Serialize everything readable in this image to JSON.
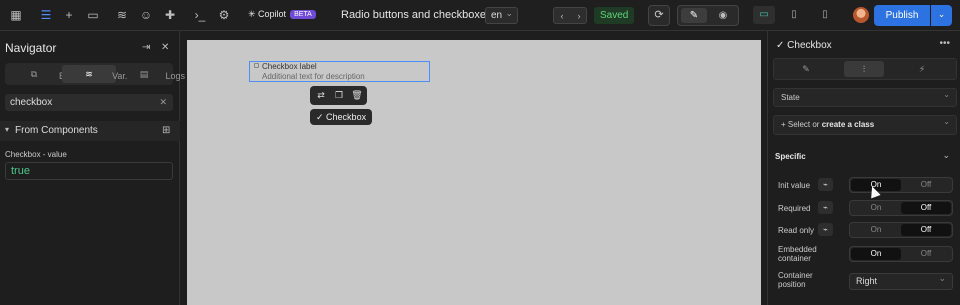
{
  "topbar": {
    "icons": [
      "grid-icon",
      "navigator-icon",
      "add-icon",
      "pages-icon",
      "cms-icon",
      "users-icon",
      "components-icon",
      "terminal-icon",
      "settings-icon"
    ],
    "copilot_label": "Copilot",
    "copilot_badge": "BETA",
    "page_title": "Radio buttons and checkboxes",
    "language": "en",
    "back": "‹",
    "forward": "›",
    "saved": "Saved",
    "publish": "Publish"
  },
  "navigator": {
    "title": "Navigator",
    "tabs": [
      {
        "label": "El."
      },
      {
        "label": "Var."
      },
      {
        "label": "Logs"
      }
    ],
    "search_value": "checkbox",
    "section_title": "From Components",
    "var_label": "Checkbox - value",
    "var_value": "true"
  },
  "canvas": {
    "checkbox_label": "Checkbox label",
    "checkbox_description": "Additional text for description",
    "selection_tag": "Checkbox"
  },
  "inspector": {
    "title": "Checkbox",
    "state_label": "State",
    "class_label_a": "+ Select or ",
    "class_label_b": "create a class",
    "specific_title": "Specific",
    "rows": [
      {
        "label": "Init value",
        "on": "On",
        "off": "Off",
        "selected": "on"
      },
      {
        "label": "Required",
        "on": "On",
        "off": "Off",
        "selected": "off"
      },
      {
        "label": "Read only",
        "on": "On",
        "off": "Off",
        "selected": "off"
      },
      {
        "label": "Embedded container",
        "on": "On",
        "off": "Off",
        "selected": "on"
      }
    ],
    "container_position_label": "Container position",
    "container_position_value": "Right"
  },
  "colors": {
    "accent": "#2c72e0",
    "saved_green": "#5fd47a",
    "value_green": "#4ec78c"
  }
}
